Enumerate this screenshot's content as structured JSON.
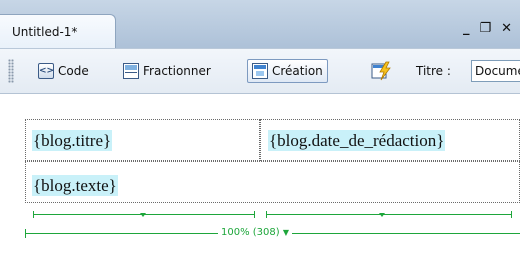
{
  "document_tab": {
    "title": "Untitled-1*"
  },
  "window_controls": {
    "minimize": "_",
    "restore": "❐",
    "close": "✕"
  },
  "toolbar": {
    "code_label": "Code",
    "split_label": "Fractionner",
    "design_label": "Création",
    "title_label": "Titre :",
    "title_value": "Document sans titre"
  },
  "table": {
    "row1": [
      "{blog.titre}",
      "{blog.date_de_rédaction}"
    ],
    "row2": [
      "{blog.texte}"
    ],
    "width_label": "100% (308)"
  },
  "colors": {
    "placeholder_highlight": "#c9f1f9",
    "guide_green": "#1ea63b",
    "active_button_border": "#7d9ac0"
  }
}
